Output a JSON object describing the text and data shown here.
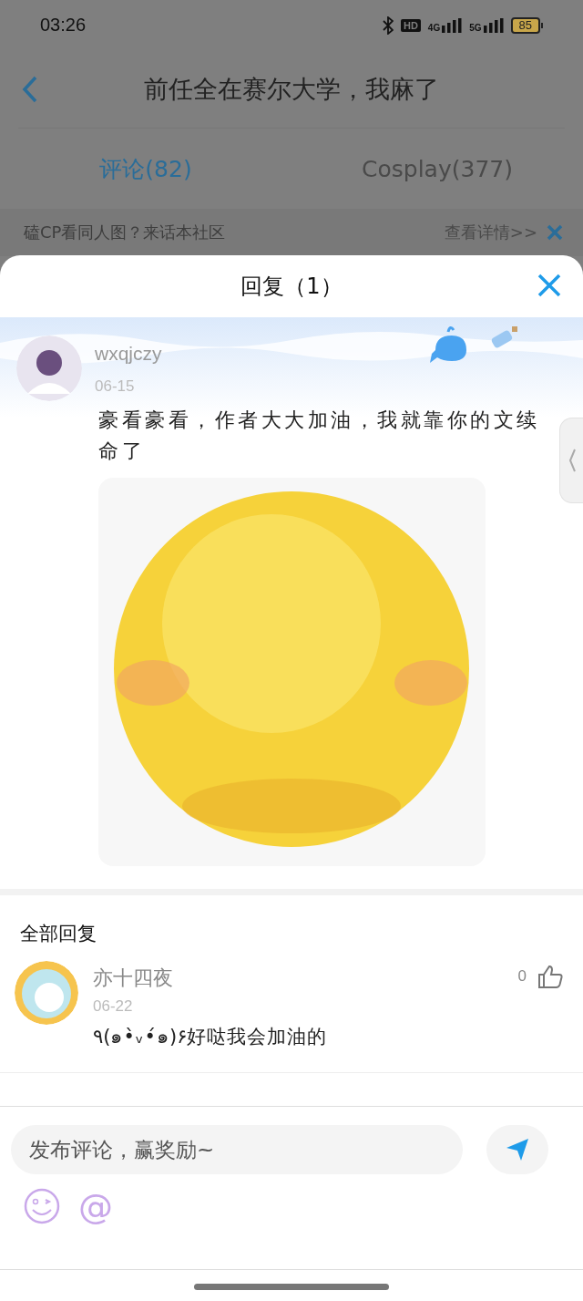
{
  "status_bar": {
    "time": "03:26",
    "hd": "HD",
    "networks": [
      "4G",
      "5G"
    ],
    "battery": "85"
  },
  "header": {
    "title": "前任全在赛尔大学，我麻了"
  },
  "tabs": [
    {
      "label": "评论(82)",
      "selected": true
    },
    {
      "label": "Cosplay(377)",
      "selected": false
    }
  ],
  "banner": {
    "text": "磕CP看同人图？来话本社区",
    "link": "查看详情>>"
  },
  "sheet": {
    "title": "回复（1）",
    "comment": {
      "user": "wxqjczy",
      "date": "06-15",
      "text": "豪看豪看，作者大大加油，我就靠你的文续命了"
    },
    "section_title": "全部回复",
    "replies": [
      {
        "user": "亦十四夜",
        "date": "06-22",
        "text": "٩(๑•̀ᵥ•́๑)۶好哒我会加油的",
        "likes": "0"
      }
    ],
    "composer": {
      "placeholder": "发布评论，赢奖励~",
      "at": "@"
    }
  }
}
